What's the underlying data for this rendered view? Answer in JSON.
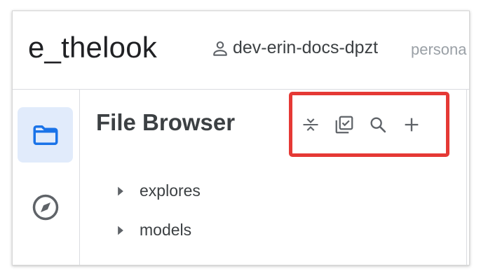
{
  "header": {
    "project_name": "e_thelook",
    "branch_icon": "person-icon",
    "branch_name": "dev-erin-docs-dpzt",
    "mode_label": "persona"
  },
  "rail": {
    "items": [
      {
        "icon": "folder-icon",
        "active": true
      },
      {
        "icon": "compass-icon",
        "active": false
      }
    ]
  },
  "file_browser": {
    "title": "File Browser",
    "toolbar": {
      "highlight_color": "#e53935",
      "actions": [
        "collapse-all-icon",
        "select-check-icon",
        "search-icon",
        "add-icon"
      ]
    },
    "folders": [
      {
        "label": "explores"
      },
      {
        "label": "models"
      }
    ]
  },
  "colors": {
    "accent": "#1a73e8",
    "active_bg": "#e1ebfb",
    "icon_gray": "#5f6368"
  }
}
